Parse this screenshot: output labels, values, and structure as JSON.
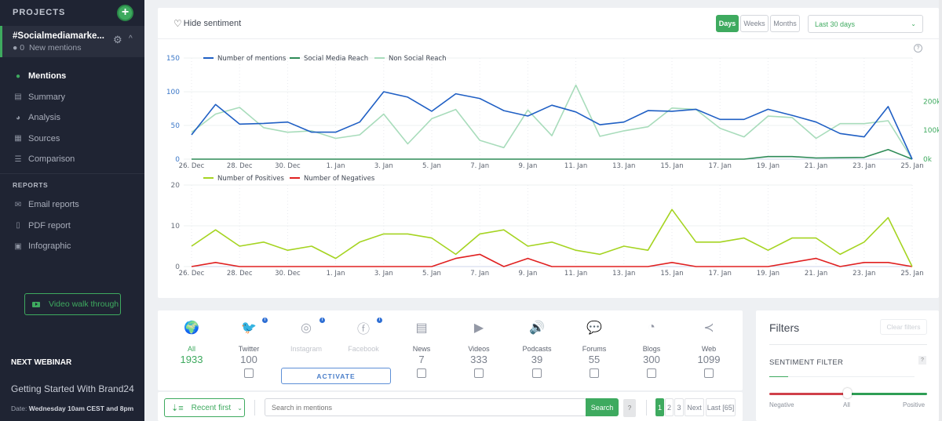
{
  "sidebar": {
    "projects_label": "PROJECTS",
    "add_icon": "plus-icon",
    "project": {
      "name": "#Socialmediamarke...",
      "new_mentions_count": "0",
      "new_mentions_label": "New mentions"
    },
    "nav": [
      {
        "label": "Mentions",
        "icon": "chat-bubbles-icon",
        "active": true
      },
      {
        "label": "Summary",
        "icon": "document-icon"
      },
      {
        "label": "Analysis",
        "icon": "pie-chart-icon"
      },
      {
        "label": "Sources",
        "icon": "briefcase-icon"
      },
      {
        "label": "Comparison",
        "icon": "compare-icon"
      }
    ],
    "reports_label": "REPORTS",
    "reports": [
      {
        "label": "Email reports",
        "icon": "envelope-icon"
      },
      {
        "label": "PDF report",
        "icon": "pdf-icon"
      },
      {
        "label": "Infographic",
        "icon": "image-icon"
      }
    ],
    "video_button": "Video walk through",
    "webinar": {
      "title": "NEXT WEBINAR",
      "name": "Getting Started With Brand24",
      "date_label": "Date:",
      "date_value": "Wednesday 10am CEST and 8pm"
    }
  },
  "chart_panel": {
    "hide_sentiment": "Hide sentiment",
    "granularity": [
      {
        "label": "Days",
        "active": true
      },
      {
        "label": "Weeks"
      },
      {
        "label": "Months"
      }
    ],
    "range": "Last 30 days",
    "help": "?"
  },
  "chart_data": [
    {
      "type": "line",
      "title": "",
      "x": [
        "26. Dec",
        "27. Dec",
        "28. Dec",
        "29. Dec",
        "30. Dec",
        "31. Dec",
        "1. Jan",
        "2. Jan",
        "3. Jan",
        "4. Jan",
        "5. Jan",
        "6. Jan",
        "7. Jan",
        "8. Jan",
        "9. Jan",
        "10. Jan",
        "11. Jan",
        "12. Jan",
        "13. Jan",
        "14. Jan",
        "15. Jan",
        "16. Jan",
        "17. Jan",
        "18. Jan",
        "19. Jan",
        "20. Jan",
        "21. Jan",
        "22. Jan",
        "23. Jan",
        "24. Jan",
        "25. Jan"
      ],
      "x_tick_labels": [
        "26. Dec",
        "28. Dec",
        "30. Dec",
        "1. Jan",
        "3. Jan",
        "5. Jan",
        "7. Jan",
        "9. Jan",
        "11. Jan",
        "13. Jan",
        "15. Jan",
        "17. Jan",
        "19. Jan",
        "21. Jan",
        "23. Jan",
        "25. Jan"
      ],
      "y_left": {
        "ylim": [
          0,
          150
        ],
        "ticks": [
          "0",
          "50",
          "100",
          "150"
        ]
      },
      "y_right": {
        "ylim": [
          0,
          350000
        ],
        "ticks": [
          "0k",
          "100k",
          "200k"
        ]
      },
      "grid": true,
      "legend": "top-left",
      "series": [
        {
          "name": "Number of mentions",
          "axis": "left",
          "color": "#1f5fc4",
          "values": [
            36,
            81,
            52,
            53,
            55,
            40,
            40,
            55,
            100,
            92,
            71,
            97,
            90,
            72,
            64,
            80,
            70,
            51,
            55,
            72,
            71,
            74,
            59,
            59,
            74,
            65,
            55,
            38,
            33,
            78,
            0
          ]
        },
        {
          "name": "Social Media Reach",
          "axis": "right",
          "color": "#2e8b57",
          "values": [
            0,
            0,
            0,
            0,
            0,
            0,
            0,
            0,
            0,
            0,
            0,
            0,
            0,
            0,
            0,
            0,
            0,
            0,
            0,
            0,
            0,
            0,
            0,
            0,
            9000,
            9000,
            4000,
            5000,
            6000,
            33000,
            0
          ]
        },
        {
          "name": "Non Social Reach",
          "axis": "right",
          "color": "#a8dcbb",
          "values": [
            93000,
            156000,
            179000,
            109000,
            93000,
            98000,
            72000,
            84000,
            156000,
            53000,
            140000,
            172000,
            65000,
            40000,
            170000,
            81000,
            256000,
            79000,
            98000,
            112000,
            177000,
            172000,
            107000,
            77000,
            149000,
            144000,
            72000,
            123000,
            123000,
            133000,
            0
          ]
        }
      ]
    },
    {
      "type": "line",
      "title": "",
      "x": [
        "26. Dec",
        "27. Dec",
        "28. Dec",
        "29. Dec",
        "30. Dec",
        "31. Dec",
        "1. Jan",
        "2. Jan",
        "3. Jan",
        "4. Jan",
        "5. Jan",
        "6. Jan",
        "7. Jan",
        "8. Jan",
        "9. Jan",
        "10. Jan",
        "11. Jan",
        "12. Jan",
        "13. Jan",
        "14. Jan",
        "15. Jan",
        "16. Jan",
        "17. Jan",
        "18. Jan",
        "19. Jan",
        "20. Jan",
        "21. Jan",
        "22. Jan",
        "23. Jan",
        "24. Jan",
        "25. Jan"
      ],
      "x_tick_labels": [
        "26. Dec",
        "28. Dec",
        "30. Dec",
        "1. Jan",
        "3. Jan",
        "5. Jan",
        "7. Jan",
        "9. Jan",
        "11. Jan",
        "13. Jan",
        "15. Jan",
        "17. Jan",
        "19. Jan",
        "21. Jan",
        "23. Jan",
        "25. Jan"
      ],
      "y_left": {
        "ylim": [
          0,
          20
        ],
        "ticks": [
          "0",
          "10",
          "20"
        ]
      },
      "grid": true,
      "legend": "top-left",
      "series": [
        {
          "name": "Number of Positives",
          "axis": "left",
          "color": "#a5d421",
          "values": [
            5,
            9,
            5,
            6,
            4,
            5,
            2,
            6,
            8,
            8,
            7,
            3,
            8,
            9,
            5,
            6,
            4,
            3,
            5,
            4,
            14,
            6,
            6,
            7,
            4,
            7,
            7,
            3,
            6,
            12,
            0
          ]
        },
        {
          "name": "Number of Negatives",
          "axis": "left",
          "color": "#e02020",
          "values": [
            0,
            1,
            0,
            0,
            0,
            0,
            0,
            0,
            0,
            0,
            0,
            2,
            3,
            0,
            2,
            0,
            0,
            0,
            0,
            0,
            1,
            0,
            0,
            0,
            0,
            1,
            2,
            0,
            1,
            1,
            0
          ]
        }
      ]
    }
  ],
  "sources": [
    {
      "label": "All",
      "count": "1933",
      "icon": "globe-icon",
      "selected": true
    },
    {
      "label": "Twitter",
      "count": "100",
      "icon": "twitter-icon",
      "info": true
    },
    {
      "label": "Instagram",
      "count": "",
      "icon": "instagram-icon",
      "info": true,
      "disabled": true
    },
    {
      "label": "Facebook",
      "count": "",
      "icon": "facebook-icon",
      "info": true,
      "disabled": true
    },
    {
      "label": "News",
      "count": "7",
      "icon": "newspaper-icon"
    },
    {
      "label": "Videos",
      "count": "333",
      "icon": "play-icon"
    },
    {
      "label": "Podcasts",
      "count": "39",
      "icon": "speaker-icon"
    },
    {
      "label": "Forums",
      "count": "55",
      "icon": "forum-bubbles-icon"
    },
    {
      "label": "Blogs",
      "count": "300",
      "icon": "rss-icon"
    },
    {
      "label": "Web",
      "count": "1099",
      "icon": "share-icon"
    }
  ],
  "activate_label": "ACTIVATE",
  "search_bar": {
    "sort_label": "Recent first",
    "search_placeholder": "Search in mentions",
    "search_value": "",
    "search_button": "Search",
    "help": "?",
    "pages": [
      "1",
      "2",
      "3",
      "Next",
      "Last [65]"
    ],
    "current_page": "1"
  },
  "filters": {
    "title": "Filters",
    "clear_label": "Clear filters",
    "sentiment_title": "SENTIMENT FILTER",
    "help": "?",
    "slider_labels": [
      "Negative",
      "All",
      "Positive"
    ],
    "slider_value": "All",
    "colors": {
      "negative": "#d0404a",
      "positive": "#2e9e55"
    }
  }
}
